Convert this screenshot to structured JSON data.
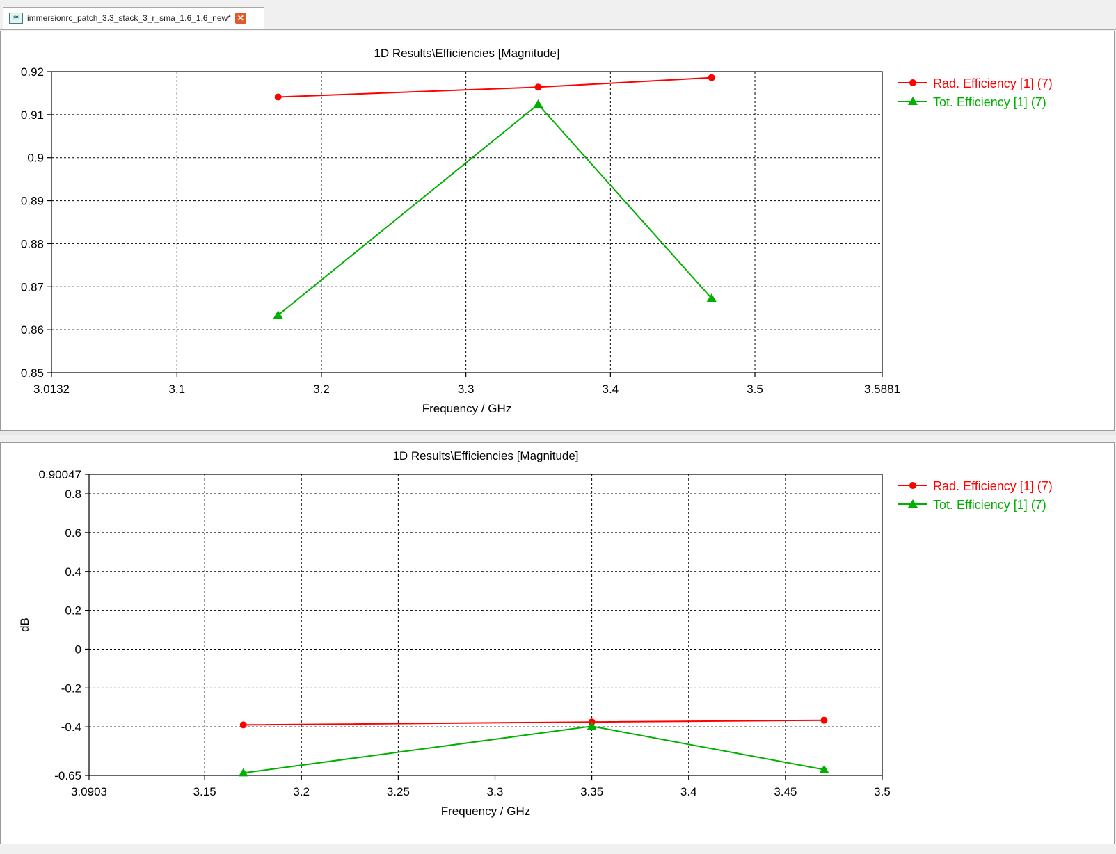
{
  "window": {
    "tab_title": "immersionrc_patch_3.3_stack_3_r_sma_1.6_1.6_new*",
    "tab_icon": "graph-icon",
    "close_icon": "close-icon"
  },
  "chart_data": [
    {
      "type": "line",
      "title": "1D Results\\Efficiencies [Magnitude]",
      "xlabel": "Frequency / GHz",
      "ylabel": "",
      "xlim": [
        3.0132,
        3.5881
      ],
      "ylim": [
        0.85,
        0.92
      ],
      "x_ticks": [
        3.0132,
        3.1,
        3.2,
        3.3,
        3.4,
        3.5,
        3.5881
      ],
      "x_tick_labels": [
        "3.0132",
        "3.1",
        "3.2",
        "3.3",
        "3.4",
        "3.5",
        "3.5881"
      ],
      "y_ticks": [
        0.85,
        0.86,
        0.87,
        0.88,
        0.89,
        0.9,
        0.91,
        0.92
      ],
      "y_tick_labels": [
        "0.85",
        "0.86",
        "0.87",
        "0.88",
        "0.89",
        "0.9",
        "0.91",
        "0.92"
      ],
      "grid": true,
      "legend_position": "right",
      "series": [
        {
          "name": "Rad. Efficiency [1] (7)",
          "color": "#ff0000",
          "marker": "circle",
          "x": [
            3.17,
            3.35,
            3.47
          ],
          "y": [
            0.9141,
            0.9164,
            0.9186
          ]
        },
        {
          "name": "Tot. Efficiency [1] (7)",
          "color": "#00b000",
          "marker": "triangle",
          "x": [
            3.17,
            3.35,
            3.47
          ],
          "y": [
            0.8634,
            0.9124,
            0.8673
          ]
        }
      ]
    },
    {
      "type": "line",
      "title": "1D Results\\Efficiencies [Magnitude]",
      "xlabel": "Frequency / GHz",
      "ylabel": "dB",
      "xlim": [
        3.0903,
        3.5
      ],
      "ylim": [
        -0.65,
        0.90047
      ],
      "x_ticks": [
        3.0903,
        3.15,
        3.2,
        3.25,
        3.3,
        3.35,
        3.4,
        3.45,
        3.5
      ],
      "x_tick_labels": [
        "3.0903",
        "3.15",
        "3.2",
        "3.25",
        "3.3",
        "3.35",
        "3.4",
        "3.45",
        "3.5"
      ],
      "y_ticks": [
        -0.65,
        -0.4,
        -0.2,
        0,
        0.2,
        0.4,
        0.6,
        0.8,
        0.90047
      ],
      "y_tick_labels": [
        "-0.65",
        "-0.4",
        "-0.2",
        "0",
        "0.2",
        "0.4",
        "0.6",
        "0.8",
        "0.90047"
      ],
      "grid": true,
      "legend_position": "right",
      "series": [
        {
          "name": "Rad. Efficiency [1] (7)",
          "color": "#ff0000",
          "marker": "circle",
          "x": [
            3.17,
            3.35,
            3.47
          ],
          "y": [
            -0.39,
            -0.375,
            -0.366
          ]
        },
        {
          "name": "Tot. Efficiency [1] (7)",
          "color": "#00b000",
          "marker": "triangle",
          "x": [
            3.17,
            3.35,
            3.47
          ],
          "y": [
            -0.637,
            -0.397,
            -0.62
          ]
        }
      ]
    }
  ]
}
